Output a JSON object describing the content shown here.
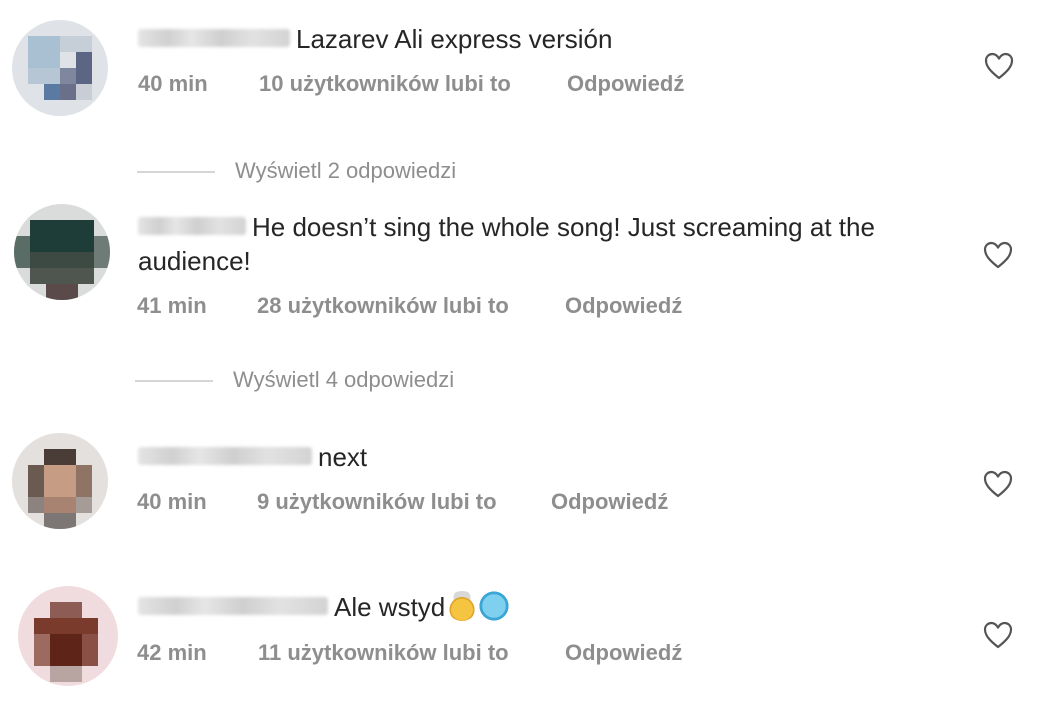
{
  "comments": [
    {
      "text": "Lazarev Ali express versión",
      "time": "40 min",
      "likes": "10 użytkowników lubi to",
      "reply": "Odpowiedź",
      "view_replies": "Wyświetl 2 odpowiedzi"
    },
    {
      "text": "He doesn’t sing the whole song! Just screaming at the",
      "text_line2": "audience!",
      "time": "41 min",
      "likes": "28 użytkowników lubi to",
      "reply": "Odpowiedź",
      "view_replies": "Wyświetl 4 odpowiedzi"
    },
    {
      "text": "next",
      "time": "40 min",
      "likes": "9 użytkowników lubi to",
      "reply": "Odpowiedź"
    },
    {
      "text": "Ale wstyd",
      "emojis": [
        "exploding-head-emoji",
        "cold-face-emoji"
      ],
      "time": "42 min",
      "likes": "11 użytkowników lubi to",
      "reply": "Odpowiedź"
    }
  ],
  "icons": {
    "like": "heart-outline-icon"
  },
  "colors": {
    "text": "#262626",
    "meta": "#8e8e8e",
    "divider": "#d6d6d6"
  }
}
